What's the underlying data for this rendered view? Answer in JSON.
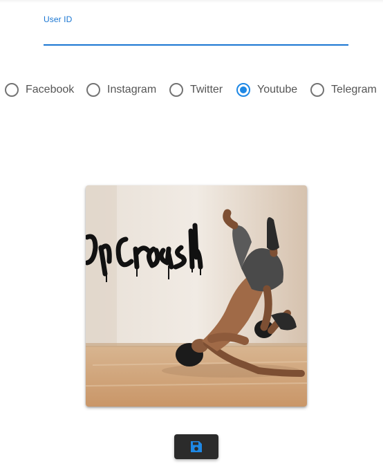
{
  "form": {
    "user_id": {
      "label": "User ID",
      "value": ""
    }
  },
  "platforms": {
    "options": [
      {
        "label": "Facebook",
        "checked": false
      },
      {
        "label": "Instagram",
        "checked": false
      },
      {
        "label": "Twitter",
        "checked": false
      },
      {
        "label": "Youtube",
        "checked": true
      },
      {
        "label": "Telegram",
        "checked": false
      }
    ],
    "selected": "Youtube"
  },
  "photo": {
    "graffiti_text": "Crash!",
    "description_icon": "breakdancer-photo"
  },
  "actions": {
    "save_icon": "floppy-disk-icon"
  },
  "colors": {
    "accent": "#1976d2",
    "radio_checked": "#1e88e5",
    "save_button_bg": "#2b2b2b",
    "save_icon": "#1e88e5"
  }
}
